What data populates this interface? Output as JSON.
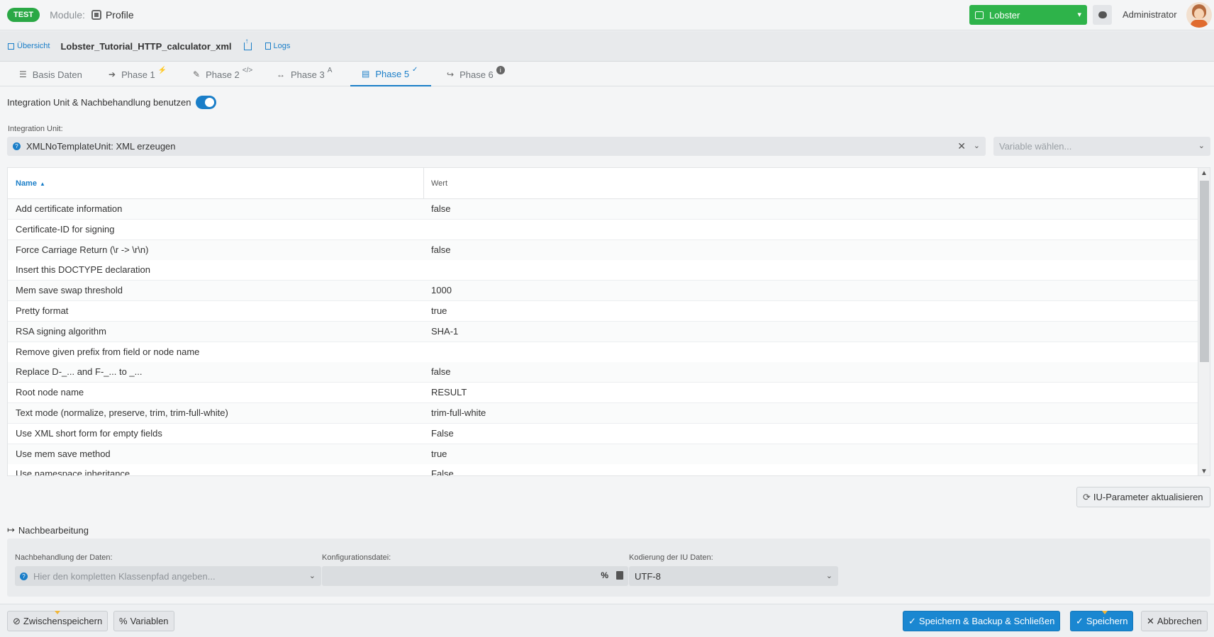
{
  "topbar": {
    "env_badge": "TEST",
    "module_label": "Module:",
    "module_name": "Profile",
    "instance_select": "Lobster",
    "user_name": "Administrator"
  },
  "breadcrumb": {
    "overview_link": "Übersicht",
    "profile_name": "Lobster_Tutorial_HTTP_calculator_xml",
    "logs_link": "Logs"
  },
  "tabs": [
    {
      "label": "Basis Daten",
      "icon": "list-icon",
      "sup": ""
    },
    {
      "label": "Phase 1",
      "icon": "sign-in-icon",
      "sup": "⚡"
    },
    {
      "label": "Phase 2",
      "icon": "file-edit-icon",
      "sup": "</>"
    },
    {
      "label": "Phase 3",
      "icon": "arrows-h-icon",
      "sup": "A"
    },
    {
      "label": "Phase 5",
      "icon": "table-icon",
      "sup": "✓"
    },
    {
      "label": "Phase 6",
      "icon": "share-icon",
      "sup": "i"
    }
  ],
  "integration": {
    "toggle_label": "Integration Unit & Nachbehandlung benutzen",
    "toggle_on": true,
    "iu_label": "Integration Unit:",
    "iu_value": "XMLNoTemplateUnit: XML erzeugen",
    "variable_placeholder": "Variable wählen..."
  },
  "table": {
    "col_name": "Name",
    "col_wert": "Wert",
    "rows": [
      {
        "name": "Add certificate information",
        "wert": "false"
      },
      {
        "name": "Certificate-ID for signing",
        "wert": ""
      },
      {
        "name": "Force Carriage Return (\\r -> \\r\\n)",
        "wert": "false"
      },
      {
        "name": "Insert this DOCTYPE declaration",
        "wert": ""
      },
      {
        "name": "Mem save swap threshold",
        "wert": "1000"
      },
      {
        "name": "Pretty format",
        "wert": "true"
      },
      {
        "name": "RSA signing algorithm",
        "wert": "SHA-1"
      },
      {
        "name": "Remove given prefix from field or node name",
        "wert": ""
      },
      {
        "name": "Replace D-_... and F-_... to _...",
        "wert": "false"
      },
      {
        "name": "Root node name",
        "wert": "RESULT"
      },
      {
        "name": "Text mode (normalize, preserve, trim, trim-full-white)",
        "wert": "trim-full-white"
      },
      {
        "name": "Use XML short form for empty fields",
        "wert": "False"
      },
      {
        "name": "Use mem save method",
        "wert": "true"
      },
      {
        "name": "Use namespace inheritance",
        "wert": "False"
      }
    ]
  },
  "iu_refresh_button": "IU-Parameter aktualisieren",
  "nachbearbeitung": {
    "title": "Nachbearbeitung",
    "nachbehandlung_label": "Nachbehandlung der Daten:",
    "nachbehandlung_placeholder": "Hier den kompletten Klassenpfad angeben...",
    "konfig_label": "Konfigurationsdatei:",
    "kodierung_label": "Kodierung der IU Daten:",
    "kodierung_value": "UTF-8"
  },
  "footer": {
    "zwischenspeichern": "Zwischenspeichern",
    "variablen": "Variablen",
    "speichern_backup": "Speichern & Backup & Schließen",
    "speichern": "Speichern",
    "abbrechen": "Abbrechen"
  },
  "colors": {
    "accent": "#1a7ec8",
    "brand_green": "#2eb34a",
    "primary_button": "#1a87d1"
  }
}
